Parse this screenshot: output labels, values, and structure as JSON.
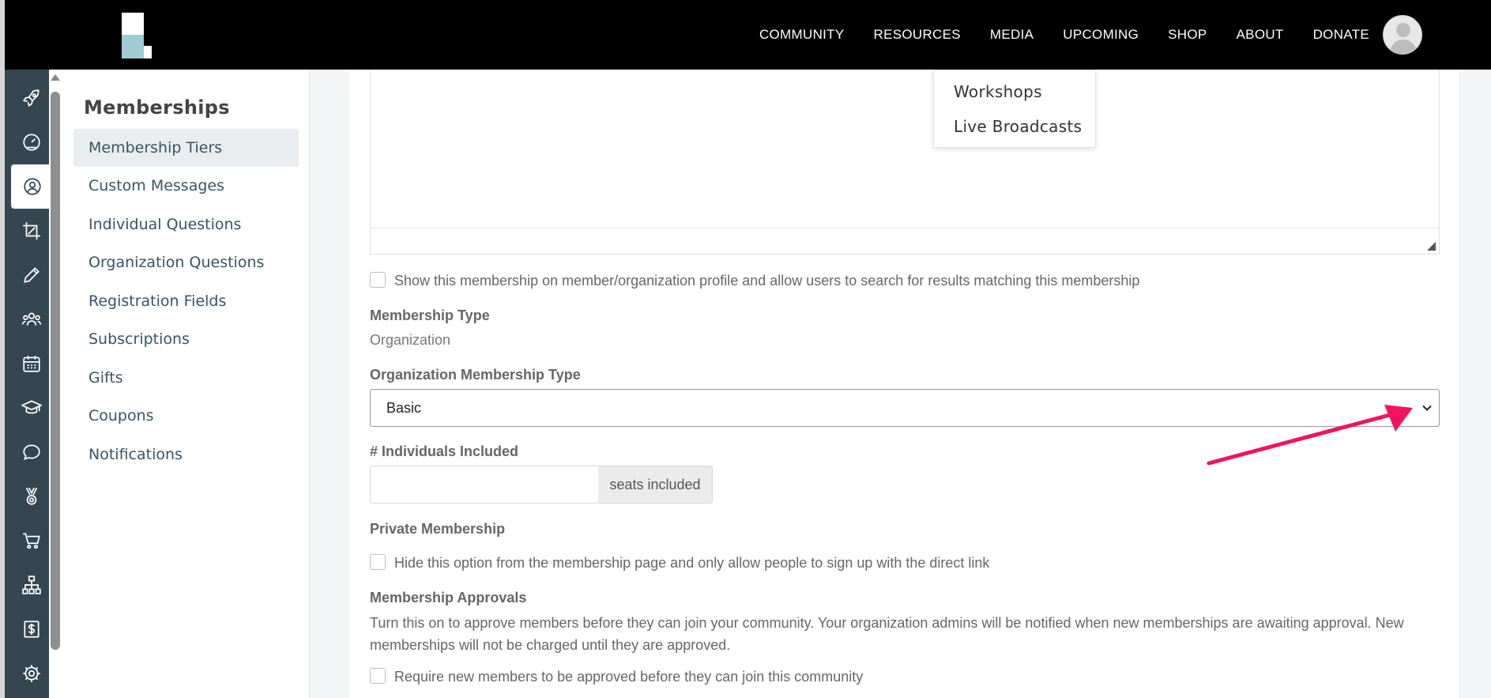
{
  "topnav": {
    "links": [
      "COMMUNITY",
      "RESOURCES",
      "MEDIA",
      "UPCOMING",
      "SHOP",
      "ABOUT",
      "DONATE"
    ]
  },
  "media_dropdown": {
    "items": [
      "Workshops",
      "Live Broadcasts"
    ]
  },
  "rail": {
    "icons": [
      "rocket-icon",
      "dashboard-gauge-icon",
      "user-circle-icon",
      "crop-icon",
      "pencil-icon",
      "users-group-icon",
      "calendar-icon",
      "graduation-cap-icon",
      "chat-bubble-icon",
      "medal-icon",
      "cart-icon",
      "org-chart-icon",
      "dollar-icon",
      "gear-icon"
    ],
    "active_index": 2
  },
  "subnav": {
    "title": "Memberships",
    "items": [
      "Membership Tiers",
      "Custom Messages",
      "Individual Questions",
      "Organization Questions",
      "Registration Fields",
      "Subscriptions",
      "Gifts",
      "Coupons",
      "Notifications"
    ],
    "active_index": 0
  },
  "form": {
    "show_on_profile_label": "Show this membership on member/organization profile and allow users to search for results matching this membership",
    "membership_type_label": "Membership Type",
    "membership_type_value": "Organization",
    "org_membership_type_label": "Organization Membership Type",
    "org_membership_type_value": "Basic",
    "individuals_included_label": "# Individuals Included",
    "individuals_included_value": "",
    "seats_addon": "seats included",
    "private_membership_label": "Private Membership",
    "private_membership_checkbox": "Hide this option from the membership page and only allow people to sign up with the direct link",
    "approvals_label": "Membership Approvals",
    "approvals_help": "Turn this on to approve members before they can join your community. Your organization admins will be notified when new memberships are awaiting approval. New memberships will not be charged until they are approved.",
    "approvals_checkbox": "Require new members to be approved before they can join this community"
  },
  "colors": {
    "annotation_arrow": "#f0145e",
    "rail_bg": "#334652",
    "subnav_text": "#385464"
  }
}
